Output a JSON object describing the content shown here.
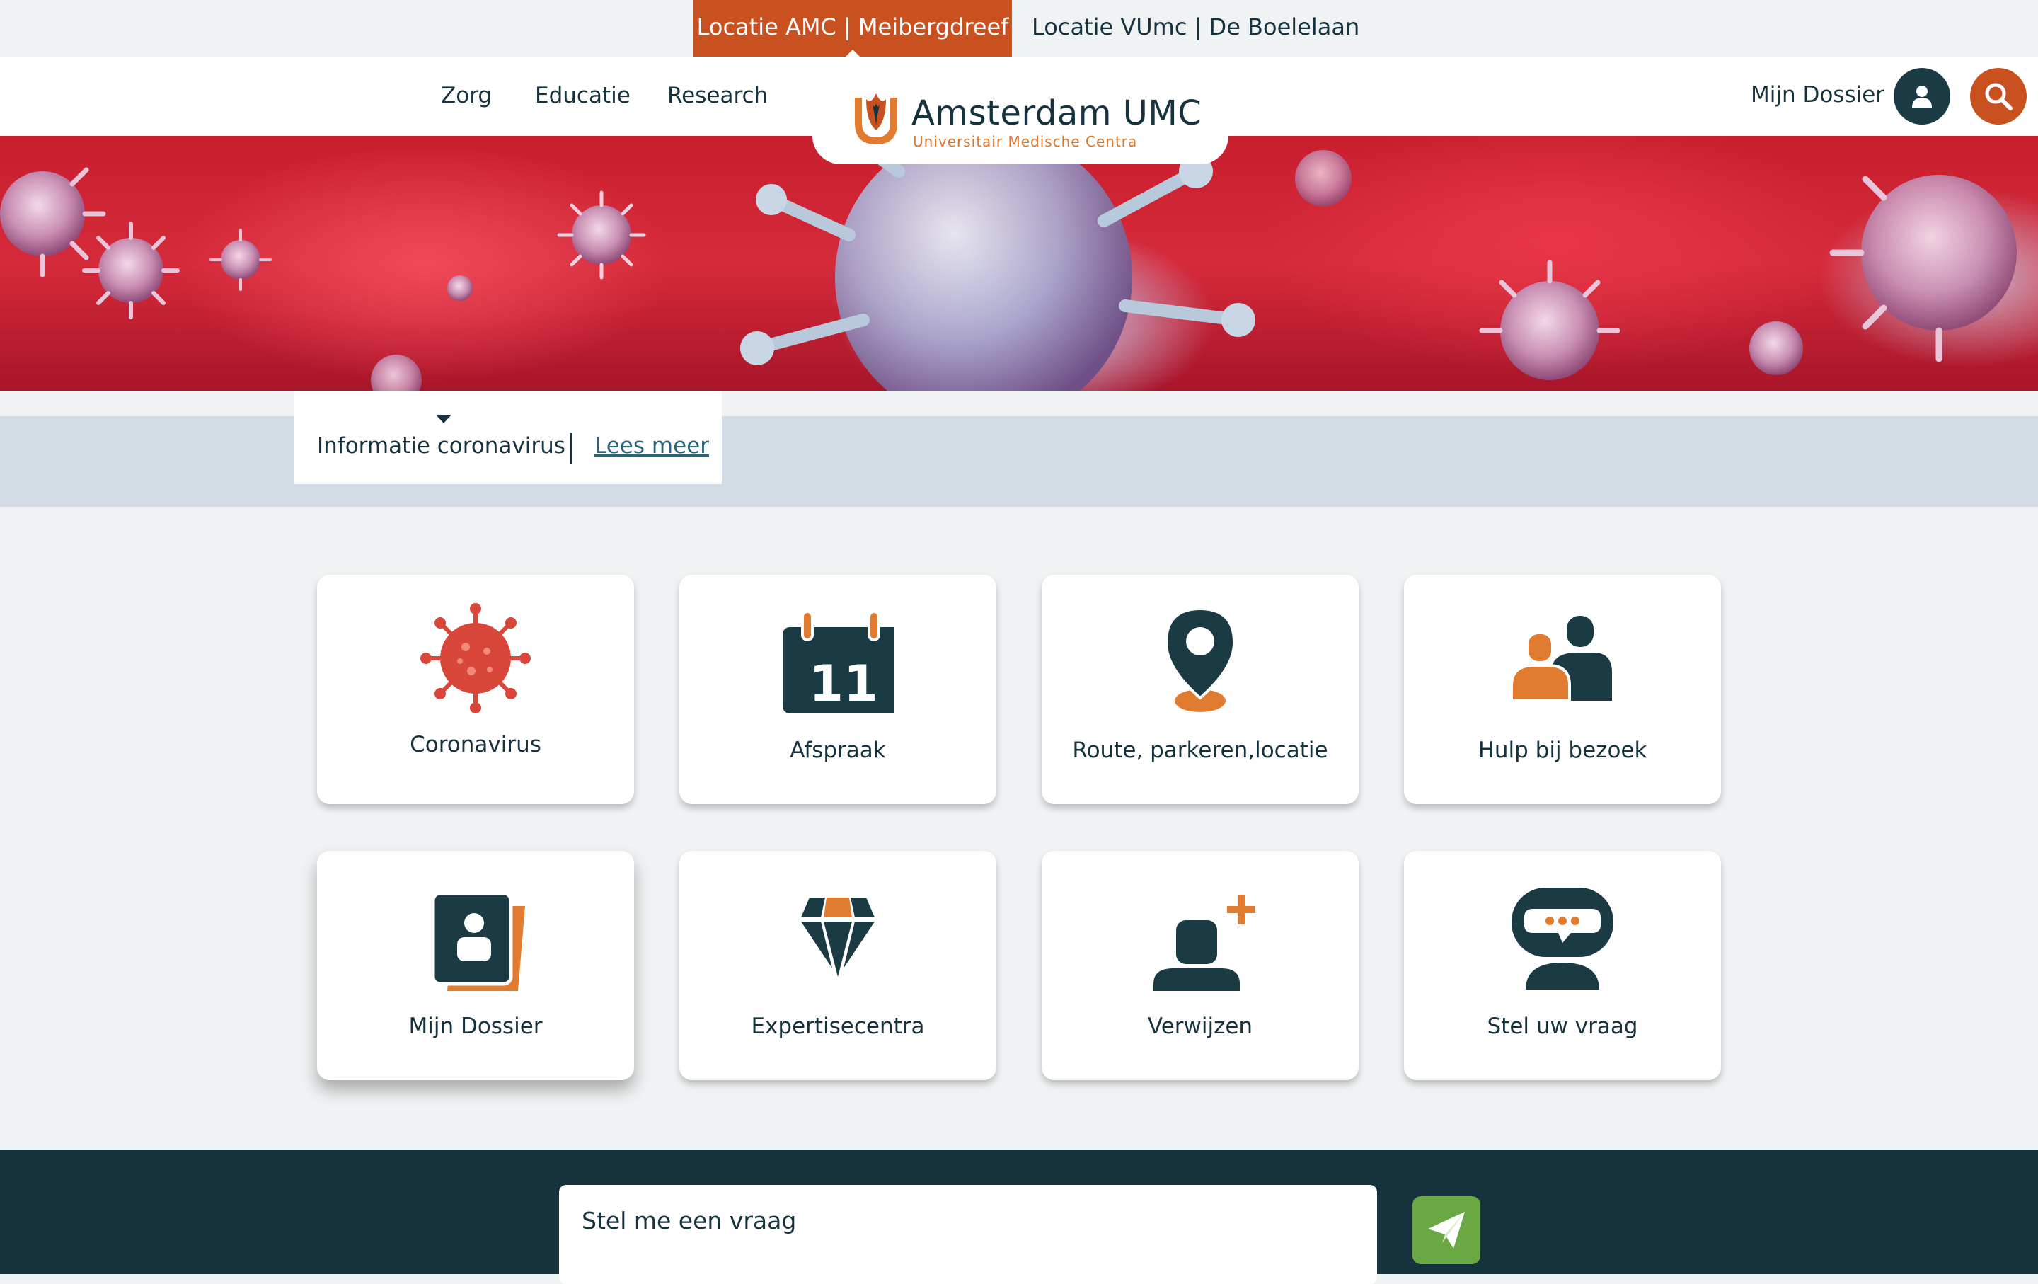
{
  "locations": {
    "active": "Locatie AMC | Meibergdreef",
    "inactive": "Locatie VUmc | De Boelelaan"
  },
  "nav": {
    "items": [
      "Zorg",
      "Educatie",
      "Research"
    ],
    "mijn_dossier": "Mijn Dossier"
  },
  "logo": {
    "title": "Amsterdam UMC",
    "subtitle": "Universitair Medische Centra"
  },
  "info": {
    "text": "Informatie coronavirus",
    "link": "Lees meer"
  },
  "tiles": [
    {
      "label": "Coronavirus",
      "icon": "virus-icon"
    },
    {
      "label": "Afspraak",
      "icon": "calendar-icon"
    },
    {
      "label": "Route, parkeren,locatie",
      "icon": "location-pin-icon"
    },
    {
      "label": "Hulp bij bezoek",
      "icon": "people-icon"
    },
    {
      "label": "Mijn Dossier",
      "icon": "dossier-icon"
    },
    {
      "label": "Expertisecentra",
      "icon": "diamond-icon"
    },
    {
      "label": "Verwijzen",
      "icon": "refer-person-icon"
    },
    {
      "label": "Stel uw vraag",
      "icon": "chat-bot-icon"
    }
  ],
  "calendar_day": "11",
  "chat": {
    "placeholder": "Stel me een vraag"
  },
  "colors": {
    "brand_orange": "#c9501f",
    "accent_orange": "#e07b2f",
    "navy": "#15323d",
    "send_green": "#6aa844",
    "virus_red": "#d9473a"
  }
}
